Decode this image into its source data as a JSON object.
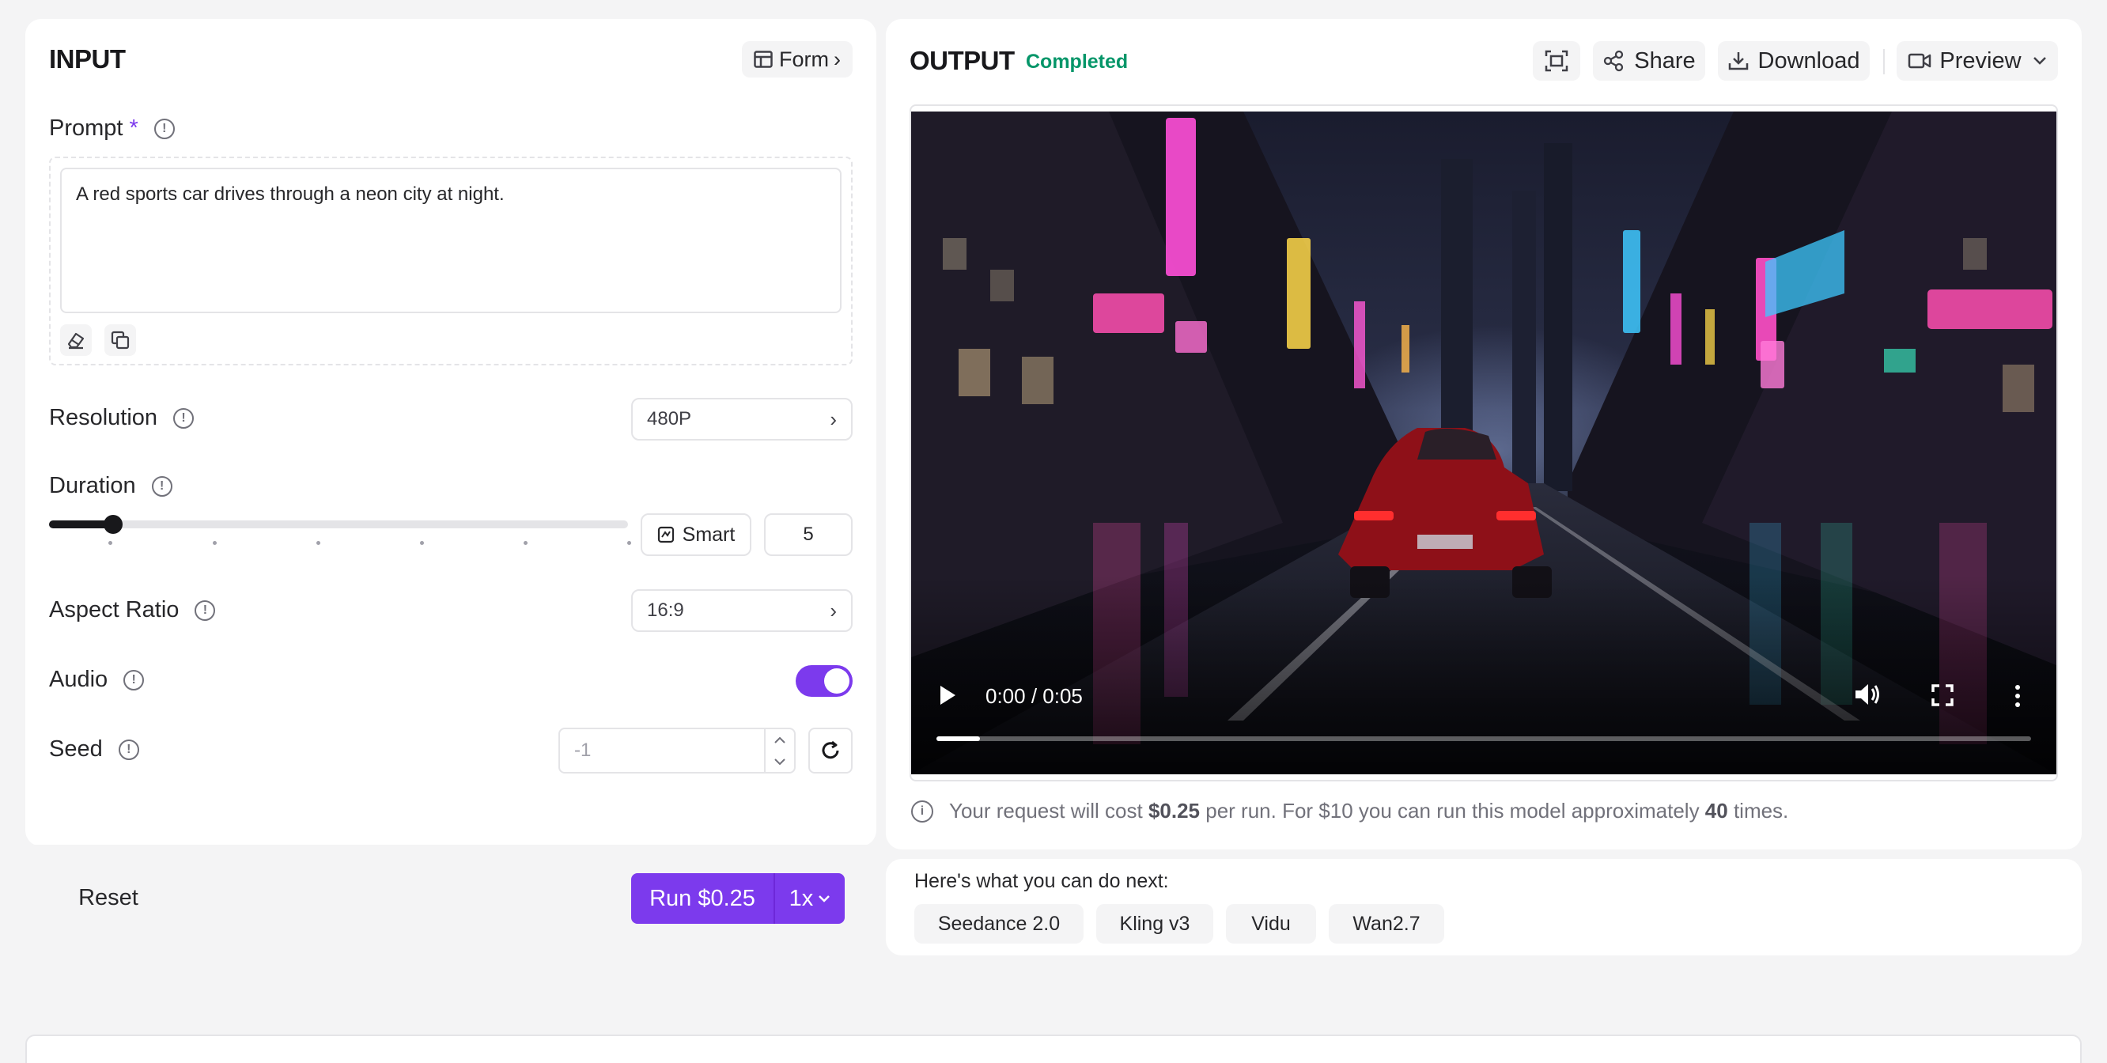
{
  "input": {
    "title": "INPUT",
    "form_button": "Form",
    "prompt_label": "Prompt",
    "prompt_required": "*",
    "prompt_value": "A red sports car drives through a neon city at night.",
    "resolution_label": "Resolution",
    "resolution_value": "480P",
    "duration_label": "Duration",
    "duration_smart": "Smart",
    "duration_value": "5",
    "duration_fraction": 0.11,
    "aspect_label": "Aspect Ratio",
    "aspect_value": "16:9",
    "audio_label": "Audio",
    "audio_on": true,
    "seed_label": "Seed",
    "seed_placeholder": "-1"
  },
  "footer": {
    "reset": "Reset",
    "run": "Run $0.25",
    "multiplier": "1x"
  },
  "output": {
    "title": "OUTPUT",
    "status": "Completed",
    "share": "Share",
    "download": "Download",
    "preview": "Preview",
    "video_time": "0:00 / 0:05",
    "video_progress": 0.04,
    "cost_prefix": "Your request will cost ",
    "cost_amount": "$0.25",
    "cost_mid": " per run. For $10 you can run this model approximately ",
    "cost_count": "40",
    "cost_suffix": " times."
  },
  "next": {
    "heading": "Here's what you can do next:",
    "chips": [
      "Seedance 2.0",
      "Kling v3",
      "Vidu",
      "Wan2.7"
    ]
  },
  "colors": {
    "accent": "#7c3aed",
    "status_green": "#059669"
  }
}
